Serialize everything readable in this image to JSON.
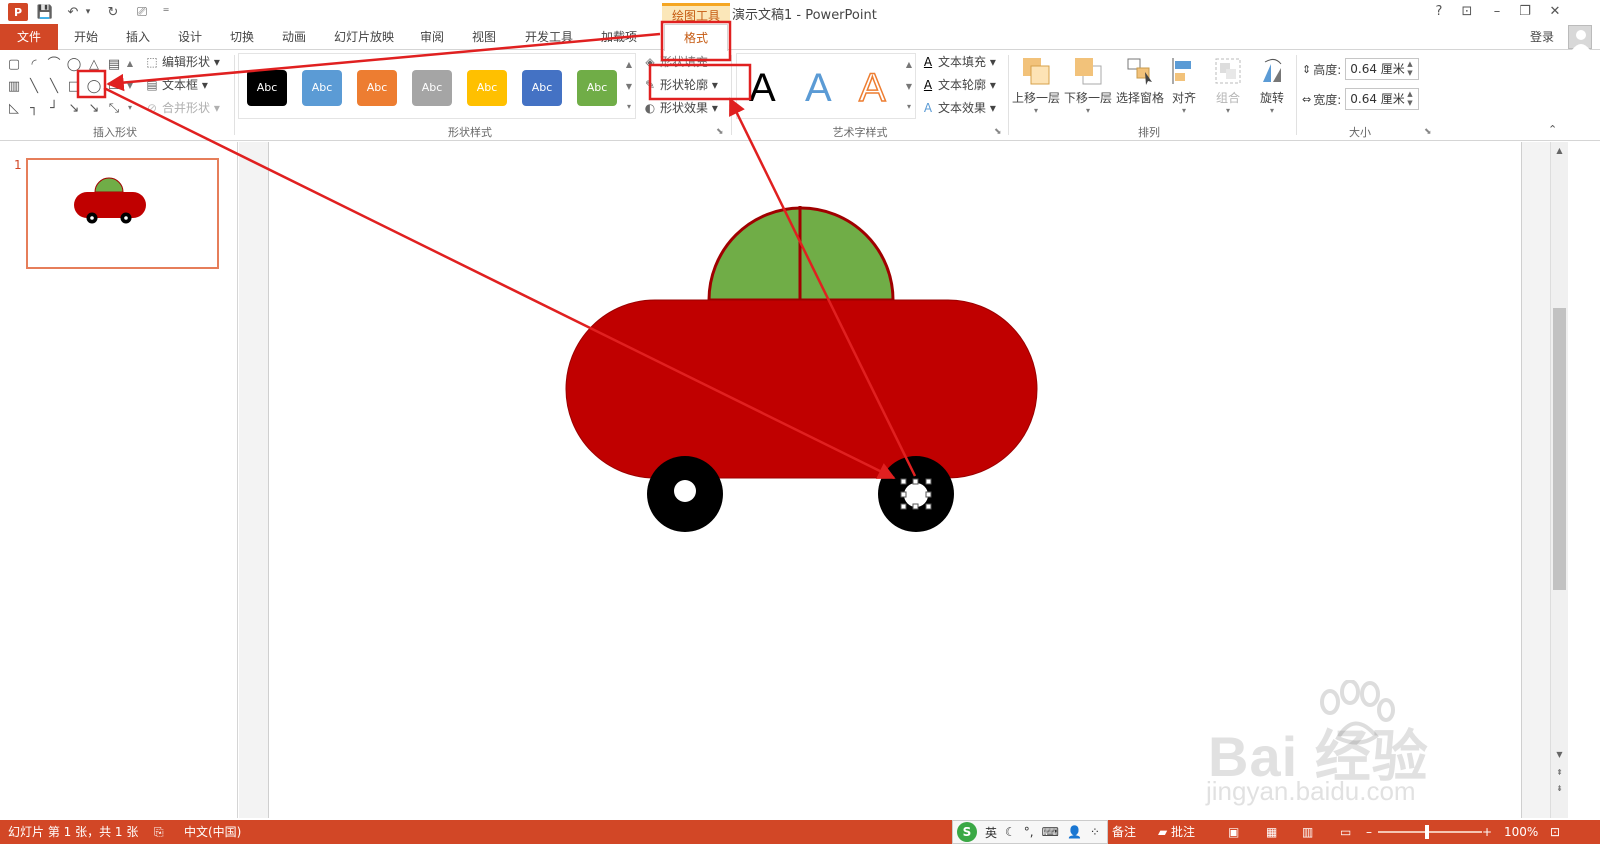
{
  "app": {
    "logo_text": "P",
    "context_tab_group": "绘图工具",
    "title": "演示文稿1 - PowerPoint",
    "window_buttons": {
      "help": "?",
      "ribbon_options": "⊡",
      "minimize": "–",
      "restore": "❐",
      "close": "✕"
    },
    "login": "登录"
  },
  "qat": {
    "save": "💾",
    "undo": "↶",
    "undo_more": "▾",
    "redo": "↻",
    "present": "⎚",
    "customize": "⁼"
  },
  "tabs": [
    {
      "label": "文件"
    },
    {
      "label": "开始"
    },
    {
      "label": "插入"
    },
    {
      "label": "设计"
    },
    {
      "label": "切换"
    },
    {
      "label": "动画"
    },
    {
      "label": "幻灯片放映"
    },
    {
      "label": "审阅"
    },
    {
      "label": "视图"
    },
    {
      "label": "开发工具"
    },
    {
      "label": "加载项"
    },
    {
      "label": "格式"
    }
  ],
  "active_tab": "格式",
  "ribbon": {
    "insert_shapes": {
      "label": "插入形状",
      "edit_shape": "编辑形状",
      "text_box": "文本框",
      "merge_shapes": "合并形状",
      "shape_icons": [
        "rect-icon",
        "rounded-rect-icon",
        "arc-icon",
        "rect2-icon",
        "triangle-icon",
        "textbox-shape-icon",
        "vtextbox-icon",
        "line-icon",
        "diag-line-icon",
        "square-icon",
        "oval-icon",
        "callout-icon",
        "right-triangle-icon",
        "elbow-connector-icon",
        "elbow-arrow-icon",
        "diag-arrow-icon",
        "double-arrow-icon",
        "more-shapes-icon"
      ]
    },
    "shape_styles": {
      "label": "形状样式",
      "swatches": [
        {
          "label": "Abc",
          "color": "#000000"
        },
        {
          "label": "Abc",
          "color": "#5b9bd5"
        },
        {
          "label": "Abc",
          "color": "#ed7d31"
        },
        {
          "label": "Abc",
          "color": "#a5a5a5"
        },
        {
          "label": "Abc",
          "color": "#ffc000"
        },
        {
          "label": "Abc",
          "color": "#4472c4"
        },
        {
          "label": "Abc",
          "color": "#70ad47"
        }
      ],
      "shape_fill": "形状填充",
      "shape_outline": "形状轮廓",
      "shape_effects": "形状效果"
    },
    "wordart_styles": {
      "label": "艺术字样式",
      "samples": [
        {
          "text": "A",
          "color": "#000000"
        },
        {
          "text": "A",
          "color": "#5b9bd5"
        },
        {
          "text": "A",
          "color": "#ed7d31"
        }
      ],
      "text_fill": "文本填充",
      "text_outline": "文本轮廓",
      "text_effects": "文本效果"
    },
    "arrange": {
      "label": "排列",
      "bring_forward": "上移一层",
      "send_backward": "下移一层",
      "selection_pane": "选择窗格",
      "align": "对齐",
      "group": "组合",
      "rotate": "旋转"
    },
    "size": {
      "label": "大小",
      "height_label": "高度:",
      "height_value": "0.64 厘米",
      "width_label": "宽度:",
      "width_value": "0.64 厘米"
    }
  },
  "thumbnails": [
    {
      "number": "1"
    }
  ],
  "statusbar": {
    "slide_info": "幻灯片 第 1 张，共 1 张",
    "language": "中文(中国)",
    "ime_logo": "S",
    "ime_mode": "英",
    "notes": "备注",
    "comments": "批注",
    "zoom": "100%"
  },
  "watermark": {
    "main": "Bai 经验",
    "sub": "jingyan.baidu.com"
  },
  "colors": {
    "accent": "#d24726",
    "car_body": "#c00000",
    "car_window": "#70ad47",
    "wheel": "#000000",
    "annotation_red": "#e02020"
  }
}
